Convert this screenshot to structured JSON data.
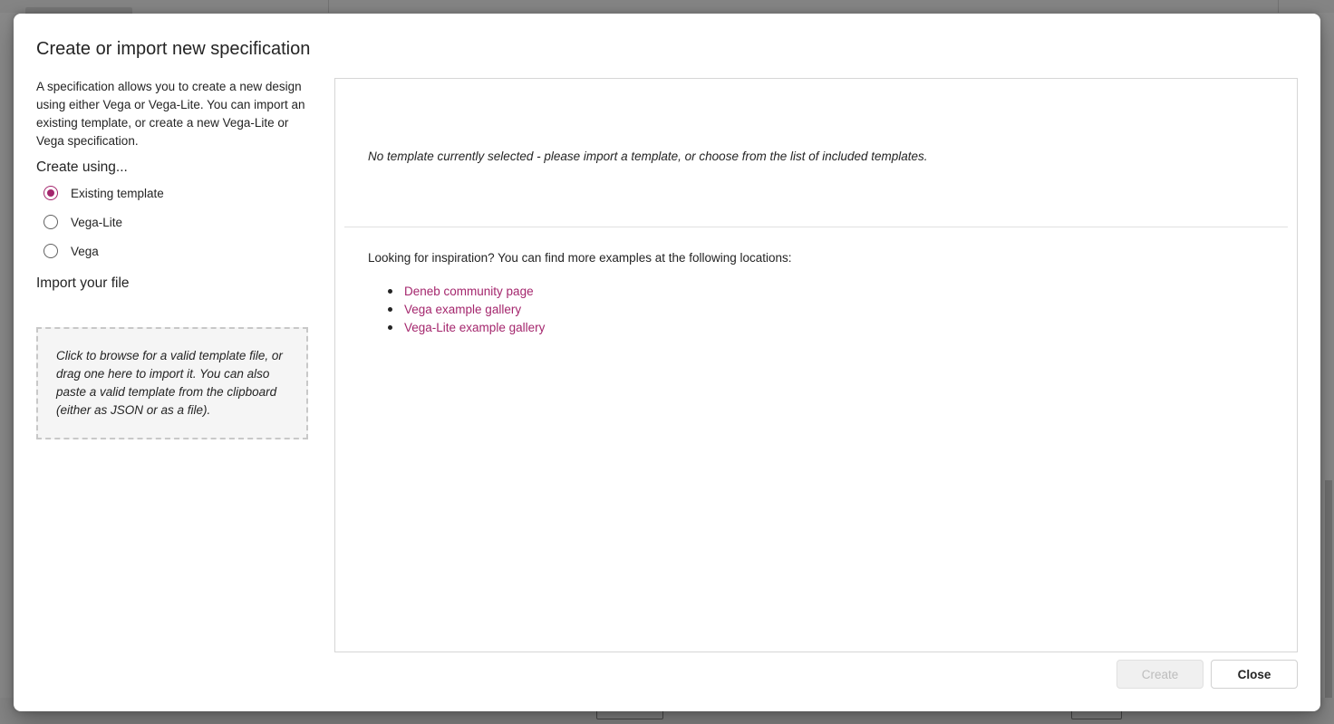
{
  "dialog": {
    "title": "Create or import new specification",
    "intro": "A specification allows you to create a new design using either Vega or Vega-Lite. You can import an existing template, or create a new Vega-Lite or Vega specification.",
    "create_using_label": "Create using...",
    "options": [
      {
        "label": "Existing template",
        "checked": true
      },
      {
        "label": "Vega-Lite",
        "checked": false
      },
      {
        "label": "Vega",
        "checked": false
      }
    ],
    "import_label": "Import your file",
    "dropzone_text": "Click to browse for a valid template file, or drag one here to import it. You can also paste a valid template from the clipboard (either as JSON or as a file).",
    "no_template_text": "No template currently selected - please import a template, or choose from the list of included templates.",
    "inspiration_text": "Looking for inspiration? You can find more examples at the following locations:",
    "links": [
      "Deneb community page",
      "Vega example gallery",
      "Vega-Lite example gallery"
    ],
    "buttons": {
      "create": "Create",
      "close": "Close"
    }
  },
  "colors": {
    "accent": "#a4266d",
    "disabled_text": "#bdbdbd",
    "overlay": "#000000"
  }
}
